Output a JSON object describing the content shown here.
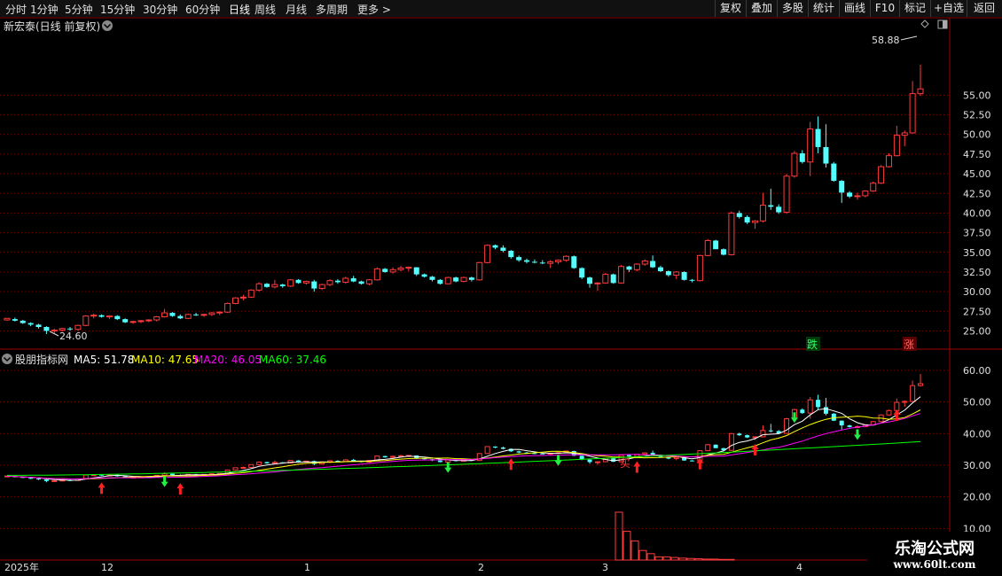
{
  "toolbar": {
    "tabs": [
      "分时",
      "1分钟",
      "5分钟",
      "15分钟",
      "30分钟",
      "60分钟",
      "日线",
      "周线",
      "月线",
      "多周期",
      "更多 >"
    ],
    "active_tab": "日线",
    "right_buttons": [
      "复权",
      "叠加",
      "多股",
      "统计",
      "画线",
      "F10",
      "标记",
      "+自选",
      "返回"
    ]
  },
  "price_panel": {
    "title": "新宏泰(日线 前复权)",
    "high_label": "58.88",
    "low_label": "24.60",
    "die_label": "跌",
    "zhang_label": "涨"
  },
  "indicator_panel": {
    "name": "股朋指标网",
    "ma5": "MA5: 51.78",
    "ma10": "MA10: 47.65",
    "ma20": "MA20: 46.05",
    "ma60": "MA60: 37.46",
    "buy_label": "买"
  },
  "time_axis": [
    "2025年",
    "12",
    "1",
    "2",
    "3",
    "4"
  ],
  "watermark": {
    "line1": "乐淘公式网",
    "line2": "www.60lt.com"
  },
  "colors": {
    "up": "#ff3b3b",
    "down": "#54ffff",
    "ma5": "#ffffff",
    "ma10": "#ffff00",
    "ma20": "#ff00ff",
    "ma60": "#00ff00",
    "grid": "#7a0000",
    "axis": "#a00000"
  },
  "chart_data": {
    "type": "candlestick",
    "price_axis_ticks": [
      25.0,
      27.5,
      30.0,
      32.5,
      35.0,
      37.5,
      40.0,
      42.5,
      45.0,
      47.5,
      50.0,
      52.5,
      55.0
    ],
    "indicator_axis_ticks": [
      10.0,
      20.0,
      30.0,
      40.0,
      50.0,
      60.0
    ],
    "candles": [
      [
        26.4,
        26.6,
        26.3,
        26.6
      ],
      [
        26.5,
        26.7,
        26.2,
        26.3
      ],
      [
        26.3,
        26.4,
        25.9,
        26.0
      ],
      [
        26.0,
        26.1,
        25.6,
        25.8
      ],
      [
        25.8,
        25.9,
        25.3,
        25.5
      ],
      [
        25.5,
        25.6,
        24.6,
        25.0
      ],
      [
        25.0,
        25.3,
        24.7,
        25.1
      ],
      [
        25.1,
        25.4,
        24.9,
        25.3
      ],
      [
        25.3,
        25.5,
        25.0,
        25.2
      ],
      [
        25.2,
        25.8,
        25.0,
        25.7
      ],
      [
        25.7,
        27.0,
        25.6,
        26.9
      ],
      [
        26.9,
        27.2,
        26.6,
        27.0
      ],
      [
        27.0,
        27.1,
        26.7,
        26.8
      ],
      [
        26.8,
        27.0,
        26.5,
        26.9
      ],
      [
        26.9,
        27.0,
        26.4,
        26.5
      ],
      [
        26.5,
        26.6,
        26.0,
        26.1
      ],
      [
        26.1,
        26.3,
        25.9,
        26.2
      ],
      [
        26.2,
        26.4,
        26.0,
        26.3
      ],
      [
        26.3,
        26.5,
        26.1,
        26.4
      ],
      [
        26.4,
        26.9,
        26.2,
        26.8
      ],
      [
        26.8,
        27.8,
        26.7,
        27.3
      ],
      [
        27.3,
        27.4,
        26.8,
        26.9
      ],
      [
        26.9,
        27.1,
        26.5,
        26.6
      ],
      [
        26.6,
        27.2,
        26.5,
        27.1
      ],
      [
        27.1,
        27.3,
        26.9,
        27.0
      ],
      [
        27.0,
        27.2,
        26.8,
        27.1
      ],
      [
        27.1,
        27.4,
        26.9,
        27.3
      ],
      [
        27.3,
        27.5,
        27.0,
        27.4
      ],
      [
        27.4,
        28.6,
        27.3,
        28.5
      ],
      [
        28.5,
        29.3,
        28.4,
        29.2
      ],
      [
        29.2,
        29.6,
        28.9,
        29.3
      ],
      [
        29.3,
        30.3,
        29.2,
        30.2
      ],
      [
        30.2,
        31.2,
        30.0,
        31.0
      ],
      [
        31.0,
        31.1,
        30.5,
        30.6
      ],
      [
        30.6,
        31.5,
        30.4,
        30.9
      ],
      [
        30.9,
        31.0,
        30.5,
        30.7
      ],
      [
        30.7,
        31.6,
        30.6,
        31.5
      ],
      [
        31.5,
        31.6,
        31.0,
        31.1
      ],
      [
        31.1,
        31.4,
        30.9,
        31.3
      ],
      [
        31.3,
        31.5,
        30.0,
        30.4
      ],
      [
        30.4,
        31.0,
        30.2,
        30.9
      ],
      [
        30.9,
        31.6,
        30.7,
        31.4
      ],
      [
        31.4,
        31.6,
        31.0,
        31.2
      ],
      [
        31.2,
        31.9,
        31.0,
        31.7
      ],
      [
        31.7,
        32.0,
        31.2,
        31.3
      ],
      [
        31.3,
        31.4,
        30.9,
        31.0
      ],
      [
        31.0,
        31.6,
        30.8,
        31.5
      ],
      [
        31.5,
        33.1,
        31.4,
        32.9
      ],
      [
        32.9,
        33.0,
        32.4,
        32.5
      ],
      [
        32.5,
        33.1,
        32.3,
        32.8
      ],
      [
        32.8,
        33.3,
        32.6,
        33.0
      ],
      [
        33.0,
        33.2,
        32.6,
        33.1
      ],
      [
        33.1,
        33.1,
        32.0,
        32.2
      ],
      [
        32.2,
        32.3,
        31.8,
        31.9
      ],
      [
        31.9,
        32.0,
        31.3,
        31.5
      ],
      [
        31.5,
        31.6,
        30.9,
        31.0
      ],
      [
        31.0,
        31.9,
        30.9,
        31.8
      ],
      [
        31.8,
        31.9,
        31.2,
        31.3
      ],
      [
        31.3,
        31.9,
        31.2,
        31.8
      ],
      [
        31.8,
        31.9,
        31.3,
        31.5
      ],
      [
        31.5,
        33.8,
        31.4,
        33.7
      ],
      [
        33.7,
        36.0,
        33.6,
        35.9
      ],
      [
        35.9,
        36.0,
        35.4,
        35.6
      ],
      [
        35.6,
        35.9,
        35.0,
        35.2
      ],
      [
        35.2,
        35.3,
        34.2,
        34.4
      ],
      [
        34.4,
        34.6,
        33.8,
        34.0
      ],
      [
        34.0,
        34.2,
        33.6,
        33.8
      ],
      [
        33.8,
        34.1,
        33.6,
        33.7
      ],
      [
        33.7,
        34.0,
        33.5,
        33.6
      ],
      [
        33.6,
        34.0,
        33.0,
        33.8
      ],
      [
        33.8,
        34.1,
        33.5,
        34.0
      ],
      [
        34.0,
        34.6,
        33.8,
        34.5
      ],
      [
        34.5,
        34.6,
        32.9,
        33.0
      ],
      [
        33.0,
        33.1,
        31.6,
        31.8
      ],
      [
        31.8,
        31.9,
        30.5,
        31.0
      ],
      [
        31.0,
        31.2,
        30.1,
        31.1
      ],
      [
        31.1,
        32.4,
        31.0,
        32.2
      ],
      [
        32.2,
        32.3,
        31.0,
        31.1
      ],
      [
        31.1,
        33.4,
        31.0,
        33.2
      ],
      [
        33.2,
        33.3,
        32.5,
        32.8
      ],
      [
        32.8,
        33.6,
        32.6,
        33.5
      ],
      [
        33.5,
        34.1,
        33.3,
        33.9
      ],
      [
        33.9,
        34.6,
        33.0,
        33.1
      ],
      [
        33.1,
        33.3,
        32.5,
        32.6
      ],
      [
        32.6,
        32.7,
        31.9,
        32.1
      ],
      [
        32.1,
        32.6,
        31.6,
        32.5
      ],
      [
        32.5,
        32.6,
        31.4,
        31.5
      ],
      [
        31.5,
        31.6,
        31.2,
        31.4
      ],
      [
        31.4,
        34.7,
        31.3,
        34.6
      ],
      [
        34.6,
        36.7,
        34.5,
        36.5
      ],
      [
        36.5,
        36.6,
        35.6,
        35.4
      ],
      [
        35.4,
        35.5,
        34.6,
        34.7
      ],
      [
        34.7,
        40.2,
        34.6,
        40.0
      ],
      [
        40.0,
        40.3,
        39.3,
        39.5
      ],
      [
        39.5,
        39.7,
        38.6,
        38.8
      ],
      [
        38.8,
        39.1,
        38.0,
        39.0
      ],
      [
        39.0,
        42.6,
        38.8,
        41.0
      ],
      [
        41.0,
        43.1,
        40.4,
        40.8
      ],
      [
        40.8,
        41.1,
        39.9,
        40.1
      ],
      [
        40.1,
        45.0,
        39.9,
        44.7
      ],
      [
        44.7,
        47.9,
        44.5,
        47.6
      ],
      [
        47.6,
        48.0,
        46.3,
        46.5
      ],
      [
        46.5,
        51.6,
        44.7,
        50.7
      ],
      [
        50.7,
        52.3,
        47.6,
        48.4
      ],
      [
        48.4,
        51.3,
        45.8,
        46.3
      ],
      [
        46.3,
        46.5,
        44.0,
        44.1
      ],
      [
        44.1,
        44.2,
        41.3,
        42.6
      ],
      [
        42.6,
        42.8,
        41.9,
        42.1
      ],
      [
        42.1,
        42.6,
        41.7,
        42.2
      ],
      [
        42.2,
        42.9,
        42.0,
        42.8
      ],
      [
        42.8,
        44.0,
        42.7,
        43.8
      ],
      [
        43.8,
        46.1,
        43.7,
        45.9
      ],
      [
        45.9,
        47.6,
        45.8,
        47.3
      ],
      [
        47.3,
        51.1,
        47.2,
        49.9
      ],
      [
        49.9,
        50.5,
        48.5,
        50.2
      ],
      [
        50.2,
        56.8,
        50.1,
        55.2
      ],
      [
        55.2,
        58.88,
        54.9,
        55.8
      ]
    ],
    "volume_bars": [
      15,
      9,
      6,
      3,
      2,
      1,
      1,
      0.8,
      0.6,
      0.5,
      0.4,
      0.3,
      0.3,
      0.2,
      0.2
    ],
    "ma60_endpoints": {
      "start": 26.8,
      "end": 37.46
    },
    "buy_arrow_indices": [
      12,
      22,
      64,
      80,
      88,
      95,
      113
    ],
    "sell_arrow_indices": [
      20,
      56,
      70,
      100,
      108
    ]
  }
}
